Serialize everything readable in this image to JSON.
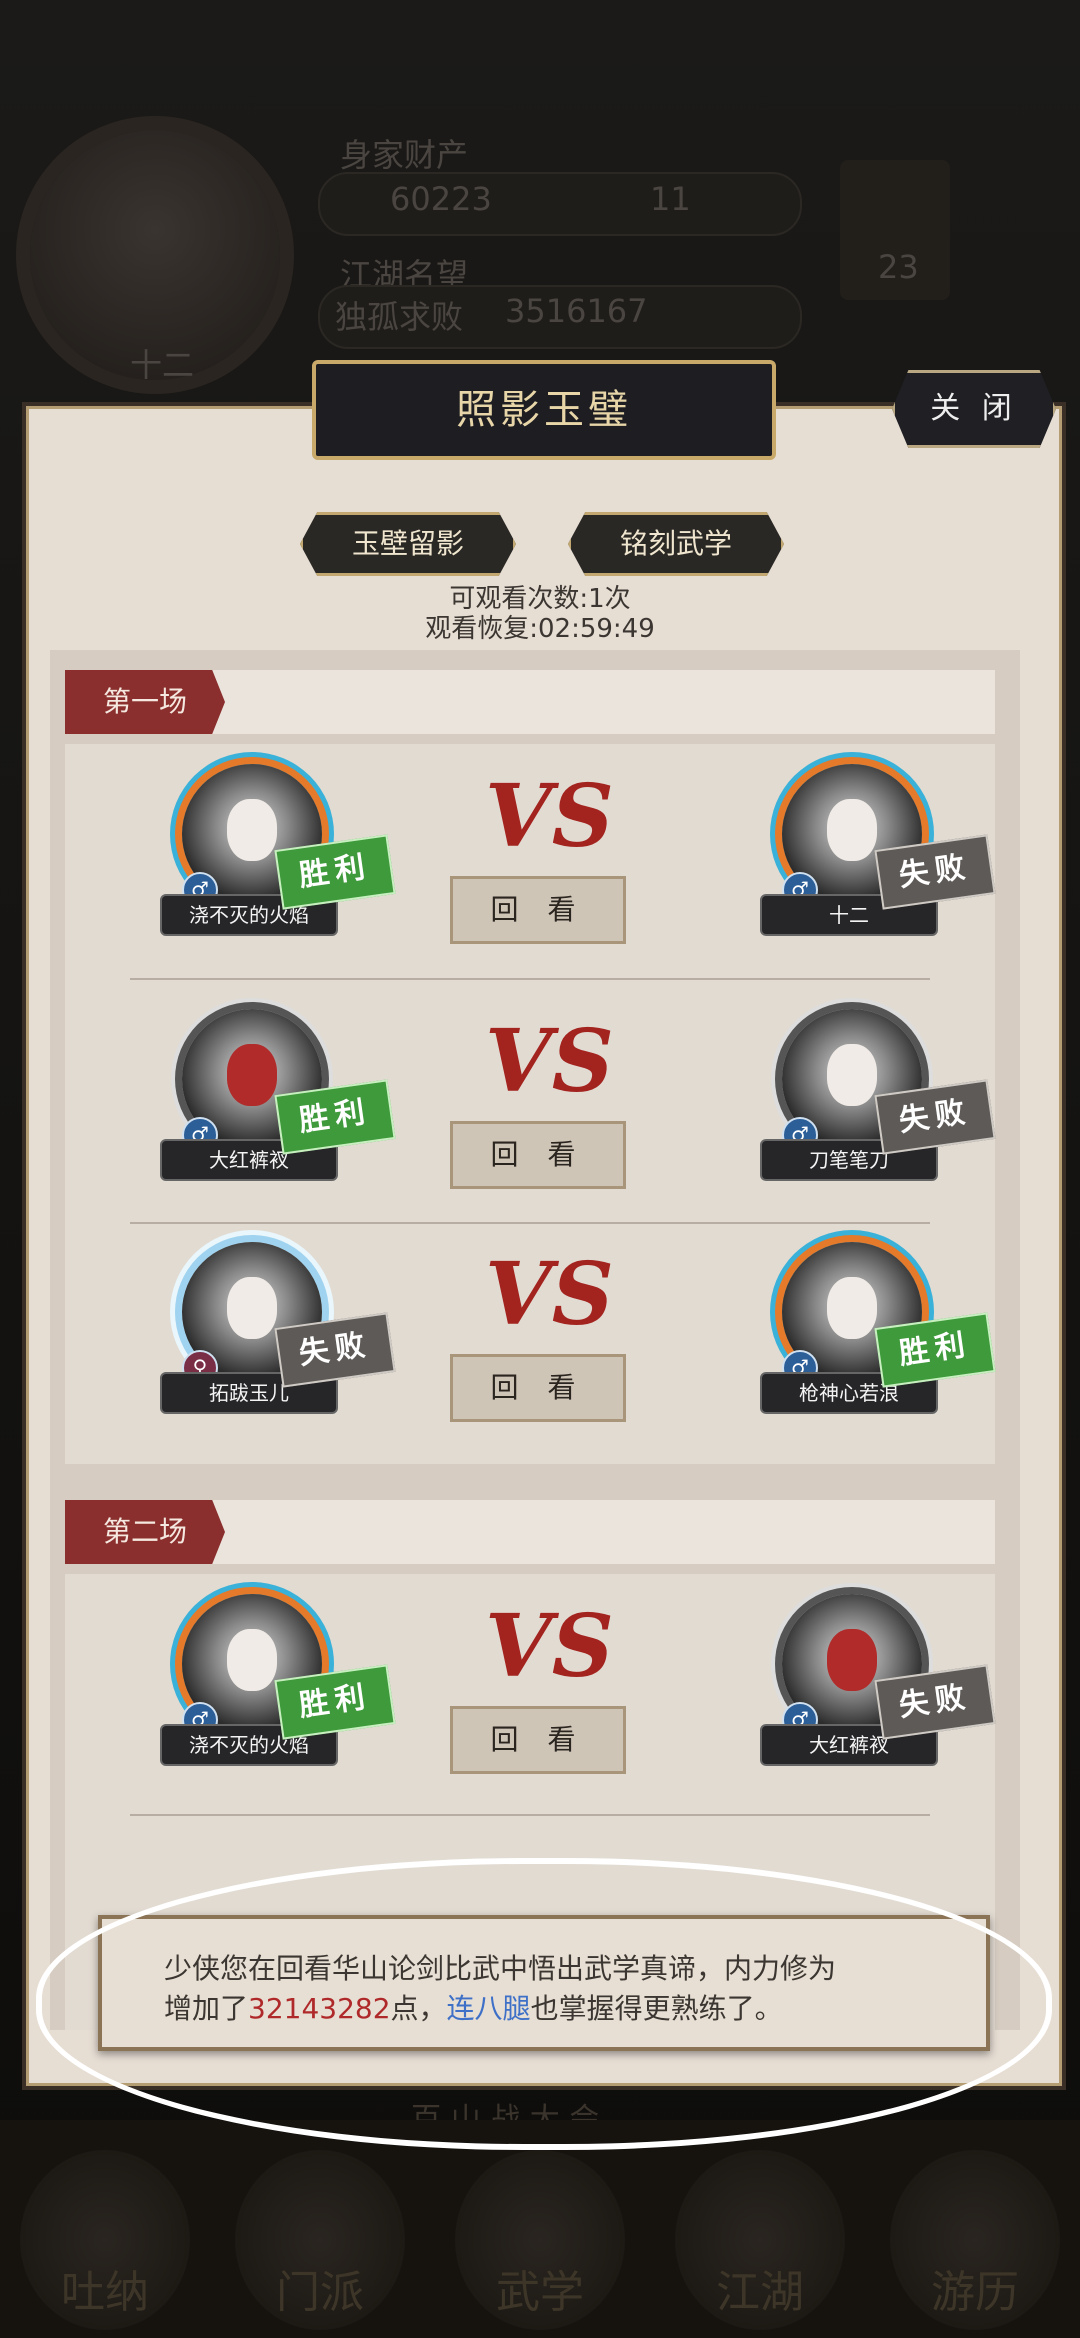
{
  "background": {
    "stats_label_1": "身家财产",
    "gold": "60223",
    "jade": "11",
    "stats_label_2": "江湖名望",
    "title": "独孤求败",
    "prestige": "3516167",
    "player_name": "十二",
    "badge_value": "23",
    "ticker": "百 山 战 大 会 ……",
    "bottom_tabs": [
      "吐纳",
      "门派",
      "武学",
      "江湖",
      "游历"
    ]
  },
  "panel": {
    "title": "照影玉璧",
    "close_label": "关 闭",
    "tabs": [
      "玉壁留影",
      "铭刻武学"
    ],
    "view_count": "可观看次数:1次",
    "recovery": "观看恢复:02:59:49"
  },
  "replay_label": "回 看",
  "vs_label": "VS",
  "matches": [
    {
      "label": "第一场",
      "rows": [
        {
          "left": {
            "name": "浇不灭的火焰",
            "gender": "♂",
            "result": "胜利"
          },
          "right": {
            "name": "十二",
            "gender": "♂",
            "result": "失败"
          }
        },
        {
          "left": {
            "name": "大红裤衩",
            "gender": "♂",
            "result": "胜利"
          },
          "right": {
            "name": "刀笔笔刀",
            "gender": "♂",
            "result": "失败"
          }
        },
        {
          "left": {
            "name": "拓跋玉儿",
            "gender": "♀",
            "result": "失败"
          },
          "right": {
            "name": "枪神心若浪",
            "gender": "♂",
            "result": "胜利"
          }
        }
      ]
    },
    {
      "label": "第二场",
      "rows": [
        {
          "left": {
            "name": "浇不灭的火焰",
            "gender": "♂",
            "result": "胜利"
          },
          "right": {
            "name": "大红裤衩",
            "gender": "♂",
            "result": "失败"
          }
        }
      ]
    }
  ],
  "toast": {
    "line1": "少侠您在回看华山论剑比武中悟出武学真谛，内力修为",
    "prefix2": "增加了",
    "number": "32143282",
    "middle2": "点，",
    "skill": "连八腿",
    "suffix2": "也掌握得更熟练了。"
  },
  "colors": {
    "panel_bg": "#e6ddd3",
    "match_label": "#8a2f2d",
    "win": "#3f9a3c",
    "lose": "#5e5a57",
    "vs": "#a3231f",
    "highlight_number": "#b0292a",
    "highlight_skill": "#3e70c8"
  }
}
